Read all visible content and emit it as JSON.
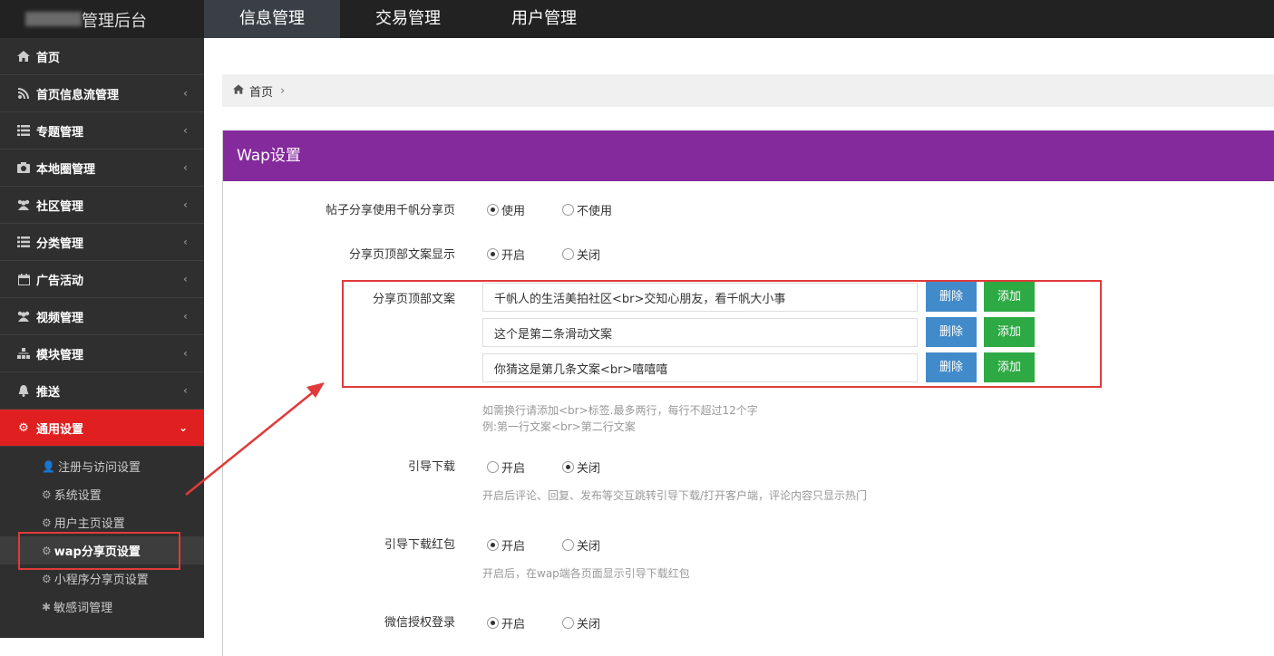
{
  "header": {
    "logo_text": "管理后台",
    "nav": [
      {
        "label": "信息管理"
      },
      {
        "label": "交易管理"
      },
      {
        "label": "用户管理"
      }
    ]
  },
  "sidebar": {
    "items": [
      {
        "label": "首页",
        "icon": "home-icon"
      },
      {
        "label": "首页信息流管理",
        "icon": "rss-icon"
      },
      {
        "label": "专题管理",
        "icon": "list-icon"
      },
      {
        "label": "本地圈管理",
        "icon": "camera-icon"
      },
      {
        "label": "社区管理",
        "icon": "users-icon"
      },
      {
        "label": "分类管理",
        "icon": "list-icon"
      },
      {
        "label": "广告活动",
        "icon": "calendar-icon"
      },
      {
        "label": "视频管理",
        "icon": "users-icon"
      },
      {
        "label": "模块管理",
        "icon": "sitemap-icon"
      },
      {
        "label": "推送",
        "icon": "bell-icon"
      },
      {
        "label": "通用设置",
        "icon": "gears-icon"
      }
    ],
    "sub_items": [
      {
        "label": "注册与访问设置",
        "icon": "user-icon"
      },
      {
        "label": "系统设置",
        "icon": "gears-icon"
      },
      {
        "label": "用户主页设置",
        "icon": "gears-icon"
      },
      {
        "label": "wap分享页设置",
        "icon": "gear-icon"
      },
      {
        "label": "小程序分享页设置",
        "icon": "gear-icon"
      },
      {
        "label": "敏感词管理",
        "icon": "asterisk-icon"
      }
    ]
  },
  "breadcrumb": {
    "home": "首页",
    "sep": "›"
  },
  "panel": {
    "title": "Wap设置",
    "share_page": {
      "label": "帖子分享使用千帆分享页",
      "opt_on": "使用",
      "opt_off": "不使用",
      "selected": "使用"
    },
    "top_copy_show": {
      "label": "分享页顶部文案显示",
      "opt_on": "开启",
      "opt_off": "关闭",
      "selected": "开启"
    },
    "top_copy": {
      "label": "分享页顶部文案",
      "items": [
        {
          "value": "千帆人的生活美拍社区<br>交知心朋友，看千帆大小事"
        },
        {
          "value": "这个是第二条滑动文案"
        },
        {
          "value": "你猜这是第几条文案<br>嘻嘻嘻"
        }
      ],
      "del_label": "删除",
      "add_label": "添加",
      "help1": "如需换行请添加<br>标签.最多两行，每行不超过12个字",
      "help2": "例:第一行文案<br>第二行文案"
    },
    "guide_download": {
      "label": "引导下载",
      "opt_on": "开启",
      "opt_off": "关闭",
      "selected": "关闭",
      "help": "开启后评论、回复、发布等交互跳转引导下载/打开客户端，评论内容只显示热门"
    },
    "guide_redpacket": {
      "label": "引导下载红包",
      "opt_on": "开启",
      "opt_off": "关闭",
      "selected": "开启",
      "help": "开启后，在wap端各页面显示引导下载红包"
    },
    "wechat_login": {
      "label": "微信授权登录",
      "opt_on": "开启",
      "opt_off": "关闭",
      "selected": "开启"
    }
  }
}
